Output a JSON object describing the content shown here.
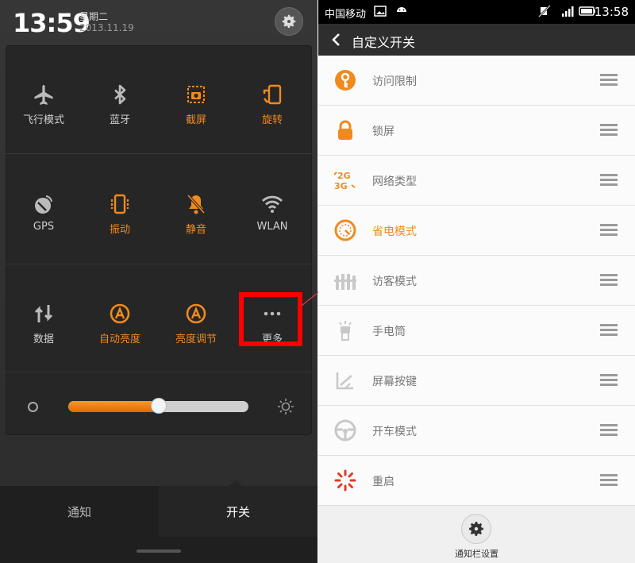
{
  "left_panel": {
    "time": "13:59",
    "weekday": "星期二",
    "date": "2013.11.19",
    "toggles": [
      {
        "label": "飞行模式",
        "icon": "airplane-icon",
        "on": false
      },
      {
        "label": "蓝牙",
        "icon": "bluetooth-icon",
        "on": false
      },
      {
        "label": "截屏",
        "icon": "screenshot-icon",
        "on": true
      },
      {
        "label": "旋转",
        "icon": "rotate-icon",
        "on": true
      },
      {
        "label": "GPS",
        "icon": "gps-icon",
        "on": false
      },
      {
        "label": "振动",
        "icon": "vibrate-icon",
        "on": true
      },
      {
        "label": "静音",
        "icon": "mute-icon",
        "on": true
      },
      {
        "label": "WLAN",
        "icon": "wifi-icon",
        "on": false
      },
      {
        "label": "数据",
        "icon": "data-icon",
        "on": false
      },
      {
        "label": "自动亮度",
        "icon": "auto-brightness-icon",
        "on": true
      },
      {
        "label": "亮度调节",
        "icon": "brightness-adjust-icon",
        "on": true
      },
      {
        "label": "更多",
        "icon": "more-icon",
        "on": false
      }
    ],
    "brightness_level": 0.5,
    "tabs": [
      "通知",
      "开关"
    ],
    "active_tab": "开关"
  },
  "right_panel": {
    "status": {
      "carrier": "中国移动",
      "time": "13:58"
    },
    "title": "自定义开关",
    "items": [
      {
        "label": "访问限制",
        "icon": "access-limit-icon",
        "highlight": false
      },
      {
        "label": "锁屏",
        "icon": "lock-icon",
        "highlight": false
      },
      {
        "label": "网络类型",
        "icon": "network-type-icon",
        "highlight": false
      },
      {
        "label": "省电模式",
        "icon": "power-save-icon",
        "highlight": true
      },
      {
        "label": "访客模式",
        "icon": "guest-mode-icon",
        "highlight": false
      },
      {
        "label": "手电筒",
        "icon": "flashlight-icon",
        "highlight": false
      },
      {
        "label": "屏幕按键",
        "icon": "screen-buttons-icon",
        "highlight": false
      },
      {
        "label": "开车模式",
        "icon": "driving-mode-icon",
        "highlight": false
      },
      {
        "label": "重启",
        "icon": "reboot-icon",
        "highlight": false
      }
    ],
    "footer_label": "通知栏设置"
  },
  "colors": {
    "accent": "#f08a1e",
    "highlight_box": "#ff0000"
  }
}
